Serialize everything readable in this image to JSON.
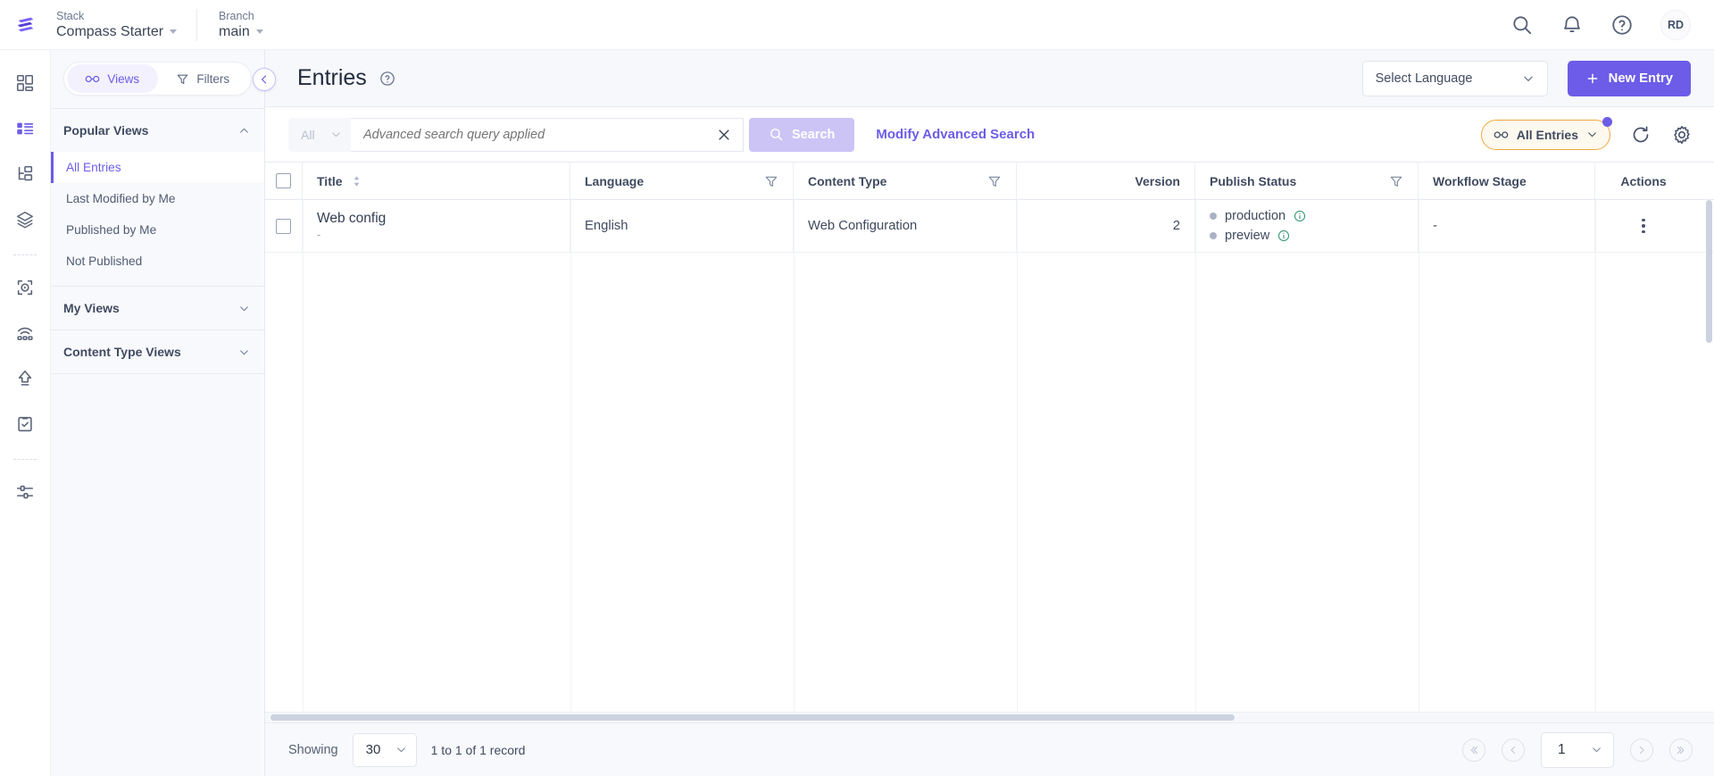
{
  "topbar": {
    "logo_icon": "contentstack-logo",
    "stack": {
      "label": "Stack",
      "value": "Compass Starter"
    },
    "branch": {
      "label": "Branch",
      "value": "main"
    },
    "search_icon": "search-icon",
    "notifications_icon": "bell-icon",
    "help_icon": "question-circle-icon",
    "avatar_initials": "RD"
  },
  "rail": {
    "items": [
      {
        "name": "dashboard",
        "icon": "dashboard-grid-icon",
        "active": false
      },
      {
        "name": "entries",
        "icon": "entries-list-icon",
        "active": true
      },
      {
        "name": "content-types",
        "icon": "content-type-hierarchy-icon",
        "active": false
      },
      {
        "name": "assets",
        "icon": "assets-layers-icon",
        "active": false
      },
      {
        "name": "media",
        "icon": "media-play-icon",
        "active": false
      },
      {
        "name": "live-preview",
        "icon": "live-preview-icon",
        "active": false
      },
      {
        "name": "releases",
        "icon": "release-upload-icon",
        "active": false
      },
      {
        "name": "workflows",
        "icon": "workflow-clipboard-icon",
        "active": false
      },
      {
        "name": "settings",
        "icon": "settings-sliders-icon",
        "active": false
      }
    ]
  },
  "sidebar": {
    "toggle": {
      "views_label": "Views",
      "views_icon": "glasses-icon",
      "filters_label": "Filters",
      "filters_icon": "funnel-icon"
    },
    "collapse_icon": "chevron-left-icon",
    "sections": [
      {
        "title": "Popular Views",
        "expanded": true,
        "items": [
          {
            "label": "All Entries",
            "active": true
          },
          {
            "label": "Last Modified by Me",
            "active": false
          },
          {
            "label": "Published by Me",
            "active": false
          },
          {
            "label": "Not Published",
            "active": false
          }
        ]
      },
      {
        "title": "My Views",
        "expanded": false,
        "items": []
      },
      {
        "title": "Content Type Views",
        "expanded": false,
        "items": []
      }
    ]
  },
  "page": {
    "title": "Entries",
    "help_icon": "question-circle-icon",
    "language_select": {
      "value": "Select Language",
      "chevron": "chevron-down-icon"
    },
    "new_entry": {
      "label": "New Entry",
      "icon": "plus-icon"
    }
  },
  "search": {
    "scope_value": "All",
    "query_text": "Advanced search query applied",
    "placeholder": "Advanced search query applied",
    "clear_icon": "close-x-icon",
    "search_button": {
      "label": "Search",
      "icon": "search-icon"
    },
    "modify_link": "Modify Advanced Search",
    "view_pill": {
      "label": "All Entries",
      "icon": "glasses-icon",
      "chevron": "chevron-down-icon",
      "badge_color": "#6c5ce7",
      "border_color": "#f0a741"
    },
    "refresh_icon": "refresh-icon",
    "settings_icon": "gear-icon"
  },
  "table": {
    "columns": [
      {
        "key": "checkbox",
        "label": "",
        "filter": false,
        "sort": false
      },
      {
        "key": "title",
        "label": "Title",
        "filter": false,
        "sort": true
      },
      {
        "key": "language",
        "label": "Language",
        "filter": true,
        "sort": false
      },
      {
        "key": "content_type",
        "label": "Content Type",
        "filter": true,
        "sort": false
      },
      {
        "key": "version",
        "label": "Version",
        "filter": false,
        "sort": false
      },
      {
        "key": "publish_status",
        "label": "Publish Status",
        "filter": true,
        "sort": false
      },
      {
        "key": "workflow_stage",
        "label": "Workflow Stage",
        "filter": false,
        "sort": false
      },
      {
        "key": "actions",
        "label": "Actions",
        "filter": false,
        "sort": false
      }
    ],
    "rows": [
      {
        "title": "Web config",
        "subtitle": "-",
        "language": "English",
        "content_type": "Web Configuration",
        "version": "2",
        "publish_status": [
          {
            "env": "production",
            "dot_color": "#aab2c4",
            "info_icon": "info-circle-icon"
          },
          {
            "env": "preview",
            "dot_color": "#aab2c4",
            "info_icon": "info-circle-icon"
          }
        ],
        "workflow_stage": "-",
        "actions_icon": "kebab-menu-icon"
      }
    ]
  },
  "footer": {
    "showing_label": "Showing",
    "page_size": "30",
    "record_summary": "1 to 1 of 1 record",
    "pagination": {
      "first_icon": "double-chevron-left-icon",
      "prev_icon": "chevron-left-icon",
      "current_page": "1",
      "next_icon": "chevron-right-icon",
      "last_icon": "double-chevron-right-icon"
    }
  }
}
